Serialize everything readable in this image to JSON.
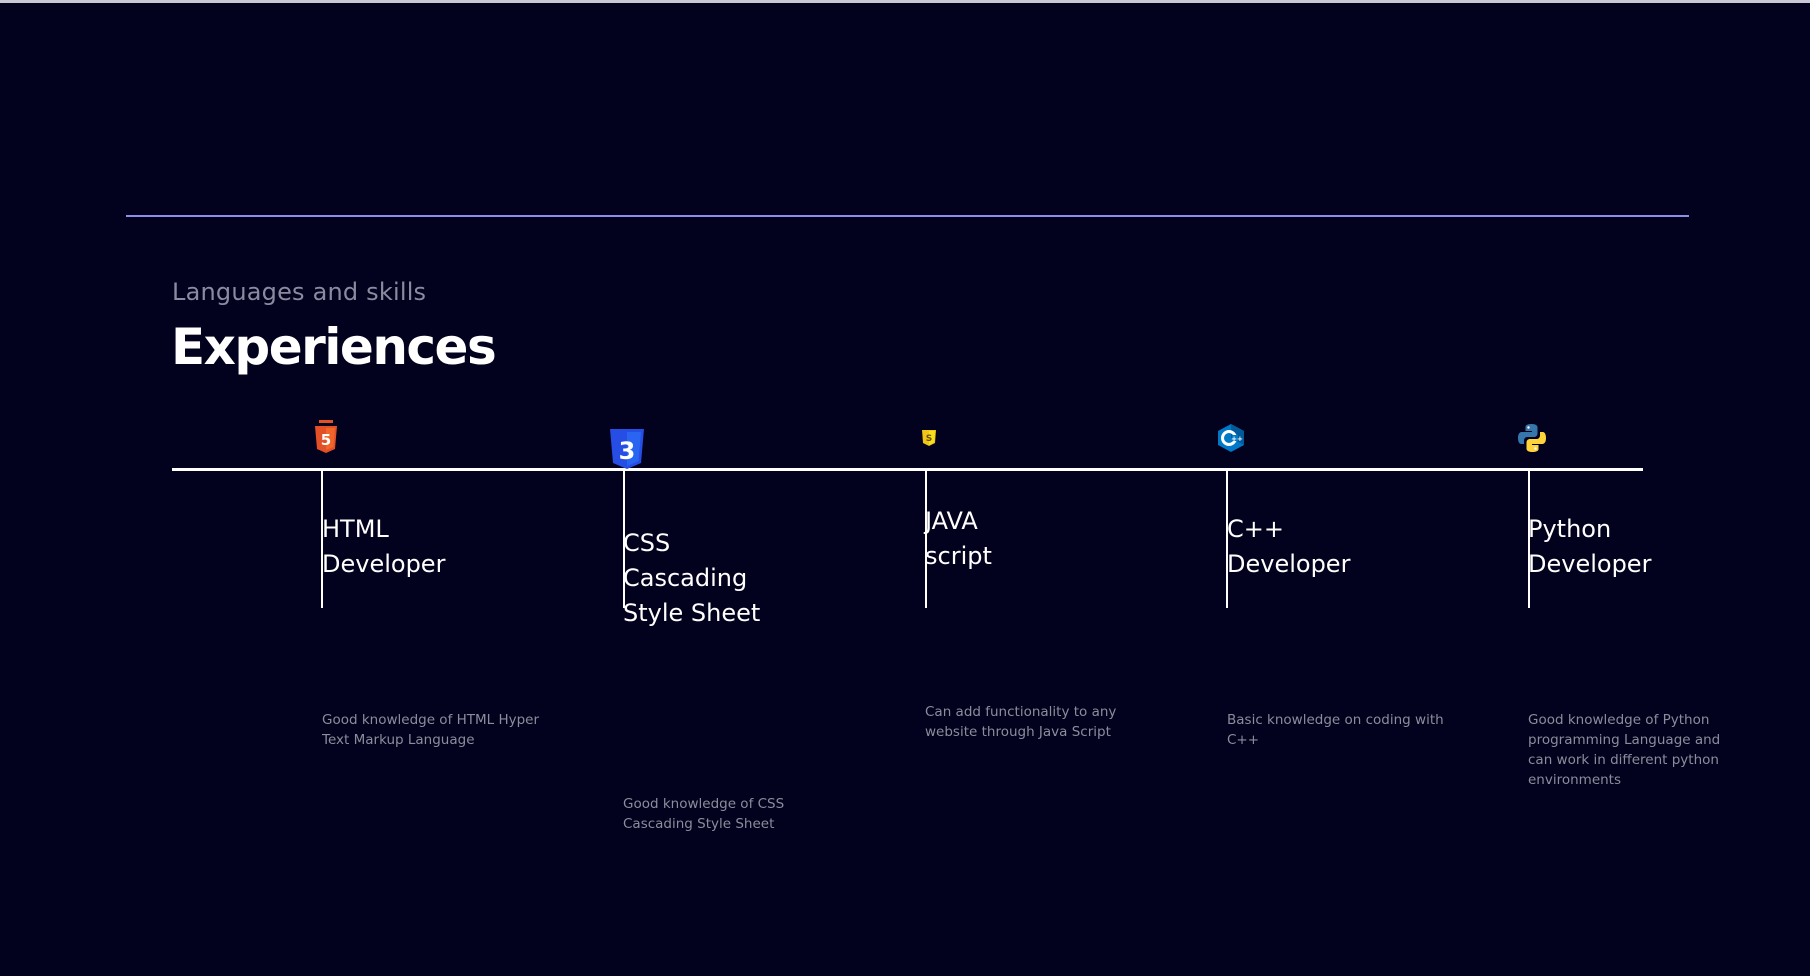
{
  "section": {
    "subtitle": "Languages and skills",
    "title": "Experiences"
  },
  "experiences": [
    {
      "icon": "html5-icon",
      "role": "HTML Developer",
      "description": "Good knowledge of HTML Hyper Text Markup Language"
    },
    {
      "icon": "css3-icon",
      "role": "CSS Cascading Style Sheet",
      "description": "Good knowledge of CSS Cascading Style Sheet"
    },
    {
      "icon": "javascript-icon",
      "role": "JAVA script",
      "description": "Can add functionality to any website through Java Script"
    },
    {
      "icon": "cplusplus-icon",
      "role": "C++ Developer",
      "description": "Basic knowledge on coding with C++"
    },
    {
      "icon": "python-icon",
      "role": "Python Developer",
      "description": "Good knowledge of Python programming Language and can work in different python environments"
    }
  ],
  "colors": {
    "background": "#02021e",
    "divider": "#8d8fe6",
    "timeline": "#ffffff",
    "description_text": "#8c8c9c"
  }
}
